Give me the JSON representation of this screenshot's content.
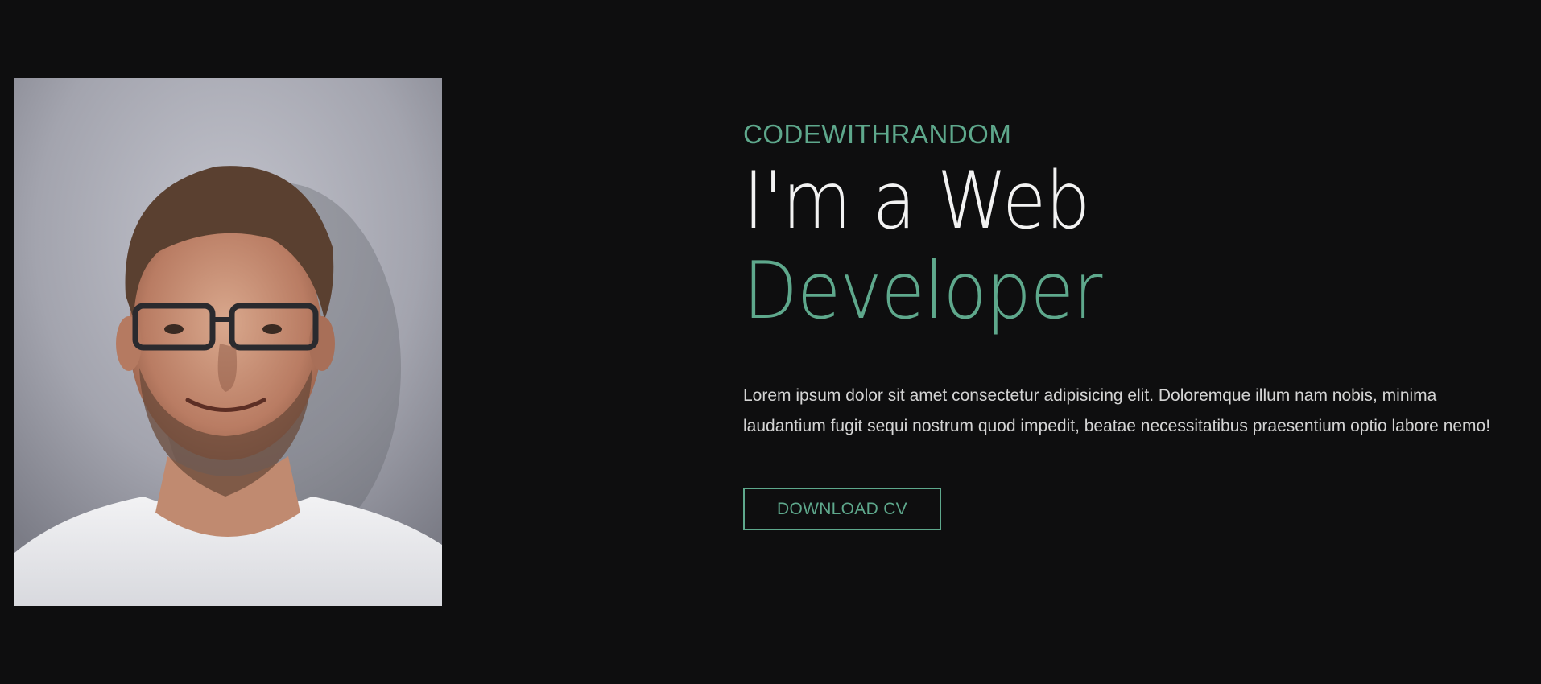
{
  "hero": {
    "brand": "CODEWITHRANDOM",
    "headline_line1": "I'm a Web",
    "headline_line2": "Developer",
    "description": "Lorem ipsum dolor sit amet consectetur adipisicing elit. Doloremque illum nam nobis, minima laudantium fugit sequi nostrum quod impedit, beatae necessitatibus praesentium optio labore nemo!",
    "button_label": "DOWNLOAD CV",
    "portrait_alt": "portrait photo"
  },
  "colors": {
    "background": "#0e0e0f",
    "accent": "#5ea88c",
    "text": "#f2f2f2",
    "muted_text": "#d4d4d4"
  }
}
